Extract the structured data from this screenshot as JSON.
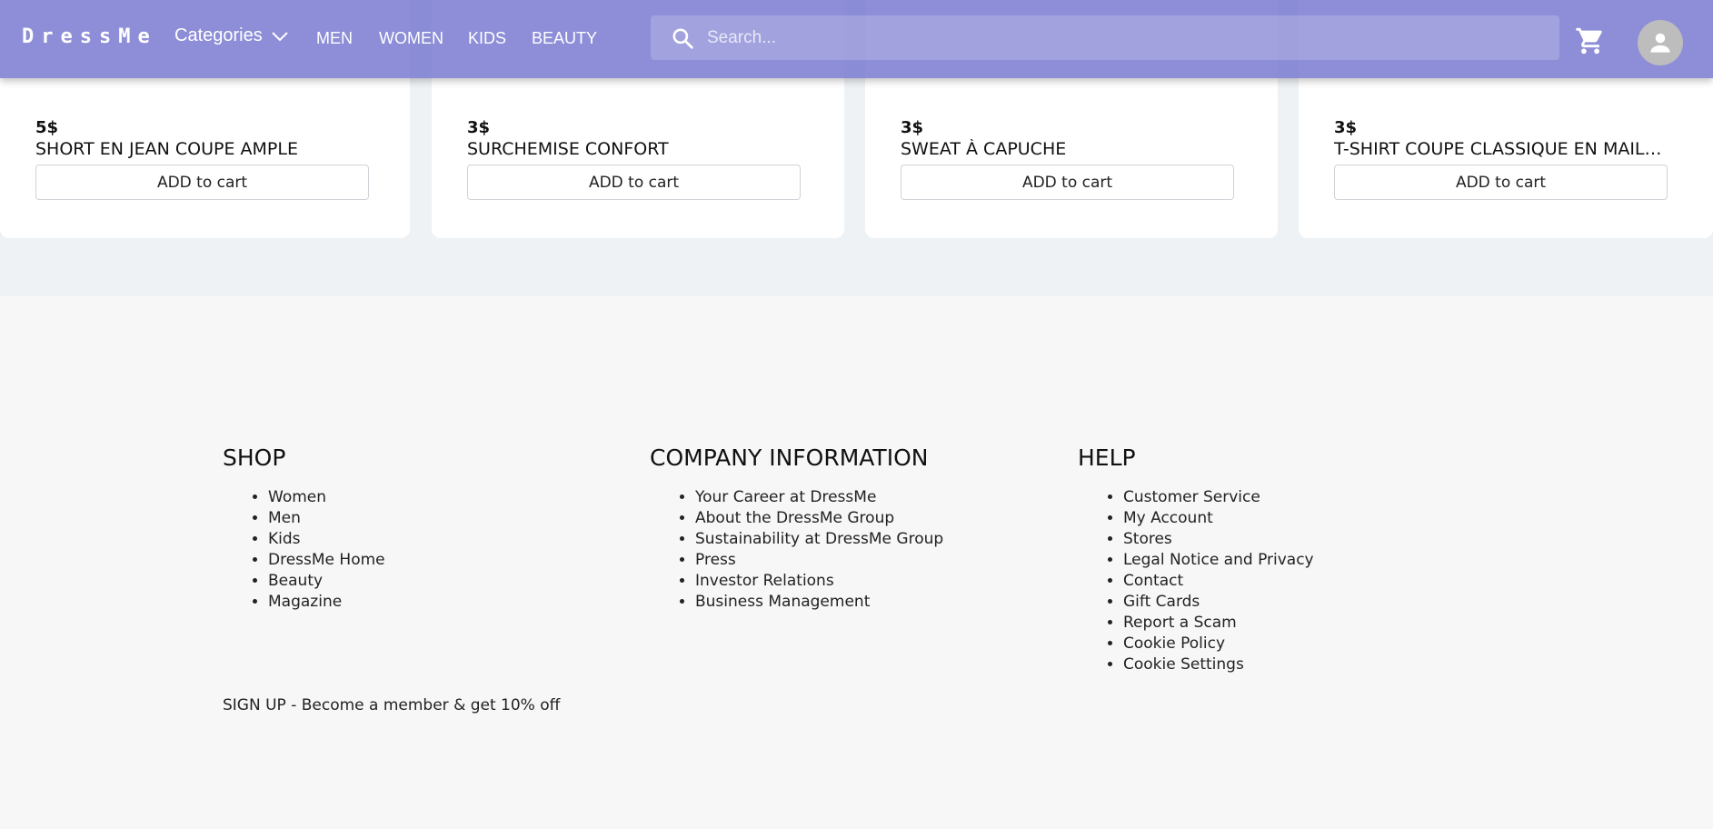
{
  "header": {
    "logo": "DressMe",
    "categories_label": "Categories",
    "nav": [
      "MEN",
      "WOMEN",
      "KIDS",
      "BEAUTY"
    ],
    "search_placeholder": "Search...",
    "cart_icon": "shopping-cart-icon",
    "avatar_icon": "account-avatar-icon",
    "accent_color": "#7575cf"
  },
  "products": [
    {
      "price": "5$",
      "title": "SHORT EN JEAN COUPE AMPLE",
      "button": "ADD to cart"
    },
    {
      "price": "3$",
      "title": "SURCHEMISE CONFORT",
      "button": "ADD to cart"
    },
    {
      "price": "3$",
      "title": "SWEAT À CAPUCHE",
      "button": "ADD to cart"
    },
    {
      "price": "3$",
      "title": "T-SHIRT COUPE CLASSIQUE EN MAILL...",
      "button": "ADD to cart"
    }
  ],
  "footer": {
    "shop": {
      "heading": "SHOP",
      "items": [
        "Women",
        "Men",
        "Kids",
        "DressMe Home",
        "Beauty",
        "Magazine"
      ]
    },
    "company": {
      "heading": "COMPANY INFORMATION",
      "items": [
        "Your Career at DressMe",
        "About the DressMe Group",
        "Sustainability at DressMe Group",
        "Press",
        "Investor Relations",
        "Business Management"
      ]
    },
    "help": {
      "heading": "HELP",
      "items": [
        "Customer Service",
        "My Account",
        "Stores",
        "Legal Notice and Privacy",
        "Contact",
        "Gift Cards",
        "Report a Scam",
        "Cookie Policy",
        "Cookie Settings"
      ]
    },
    "signup": "SIGN UP - Become a member & get 10% off"
  }
}
